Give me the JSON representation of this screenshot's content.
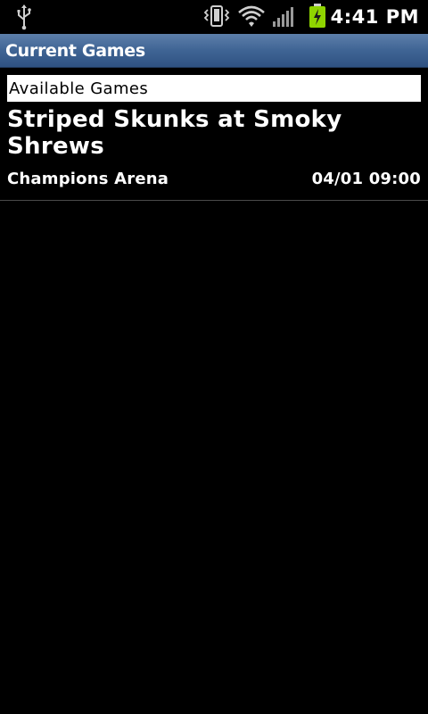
{
  "status_bar": {
    "time": "4:41 PM",
    "icons": [
      "usb-icon",
      "vibrate-icon",
      "wifi-icon",
      "signal-icon",
      "battery-charging-icon"
    ],
    "battery_color": "#8fd400"
  },
  "title_bar": {
    "title": "Current Games"
  },
  "list": {
    "section_header": "Available Games",
    "games": [
      {
        "title": "Striped Skunks at Smoky Shrews",
        "venue": "Champions Arena",
        "datetime": "04/01 09:00"
      }
    ]
  }
}
